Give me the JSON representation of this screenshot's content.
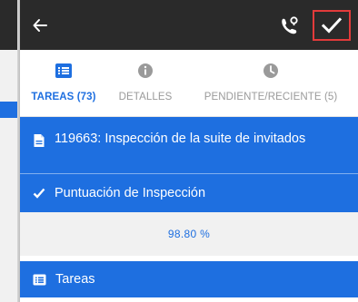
{
  "colors": {
    "topbar": "#2a2a2a",
    "accent": "#1e6fe0",
    "highlight_border": "#e23b3b",
    "muted": "#9a9a9a"
  },
  "topbar": {
    "back_icon": "arrow-left-icon",
    "phone_icon": "phone-location-icon",
    "confirm_icon": "checkmark-icon"
  },
  "tabs": [
    {
      "label": "TAREAS (73)",
      "icon": "list-icon",
      "active": true
    },
    {
      "label": "DETALLES",
      "icon": "info-icon",
      "active": false
    },
    {
      "label": "PENDIENTE/RECIENTE (5)",
      "icon": "clock-icon",
      "active": false
    }
  ],
  "inspection": {
    "title": "119663: Inspección de la suite de invitados",
    "title_icon": "document-icon"
  },
  "score": {
    "label": "Puntuación de Inspección",
    "icon": "checkmark-icon",
    "value": "98.80 %"
  },
  "tasks": {
    "label": "Tareas",
    "icon": "list-icon"
  }
}
